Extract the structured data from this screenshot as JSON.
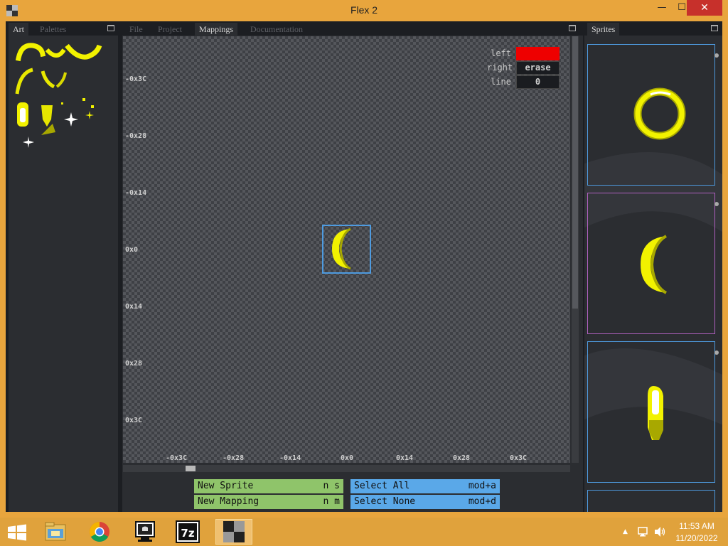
{
  "window": {
    "title": "Flex 2"
  },
  "titlebar_buttons": {
    "minimize": "—",
    "maximize": "☐",
    "close": "✕"
  },
  "art_panel": {
    "tabs": [
      {
        "label": "Art",
        "active": true
      },
      {
        "label": "Palettes",
        "active": false
      }
    ]
  },
  "editor_panel": {
    "tabs": [
      {
        "label": "File",
        "active": false
      },
      {
        "label": "Project",
        "active": false
      },
      {
        "label": "Mappings",
        "active": true
      },
      {
        "label": "Documentation",
        "active": false
      }
    ],
    "y_axis_labels": [
      "-0x3C",
      "-0x28",
      "-0x14",
      "0x0",
      "0x14",
      "0x28",
      "0x3C"
    ],
    "x_axis_labels": [
      "-0x3C",
      "-0x28",
      "-0x14",
      "0x0",
      "0x14",
      "0x28",
      "0x3C"
    ],
    "tools": {
      "left": {
        "label": "left",
        "value": "",
        "color": "#ee0000"
      },
      "right": {
        "label": "right",
        "value": "erase"
      },
      "line": {
        "label": "line",
        "value": "0"
      }
    },
    "commands": [
      {
        "label": "New Sprite",
        "key": "n s"
      },
      {
        "label": "New Mapping",
        "key": "n m"
      },
      {
        "label": "Select All",
        "key": "mod+a"
      },
      {
        "label": "Select None",
        "key": "mod+d"
      }
    ]
  },
  "sprites_panel": {
    "tabs": [
      {
        "label": "Sprites",
        "active": true
      }
    ]
  },
  "colors": {
    "titlebar": "#e8a53d",
    "close_button": "#c7302b",
    "sprite_yellow": "#f2f200",
    "sprite_dark_yellow": "#a8a800",
    "selection": "#4e9be0",
    "command_green": "#8fc46a",
    "command_blue": "#5aa8e8"
  },
  "taskbar": {
    "apps": [
      {
        "name": "file-explorer-icon"
      },
      {
        "name": "chrome-icon"
      },
      {
        "name": "monitor-app-icon"
      },
      {
        "name": "7zip-icon",
        "label": "7z"
      },
      {
        "name": "flex2-taskbar-icon",
        "active": true
      }
    ],
    "time": "11:53 AM",
    "date": "11/20/2022"
  }
}
